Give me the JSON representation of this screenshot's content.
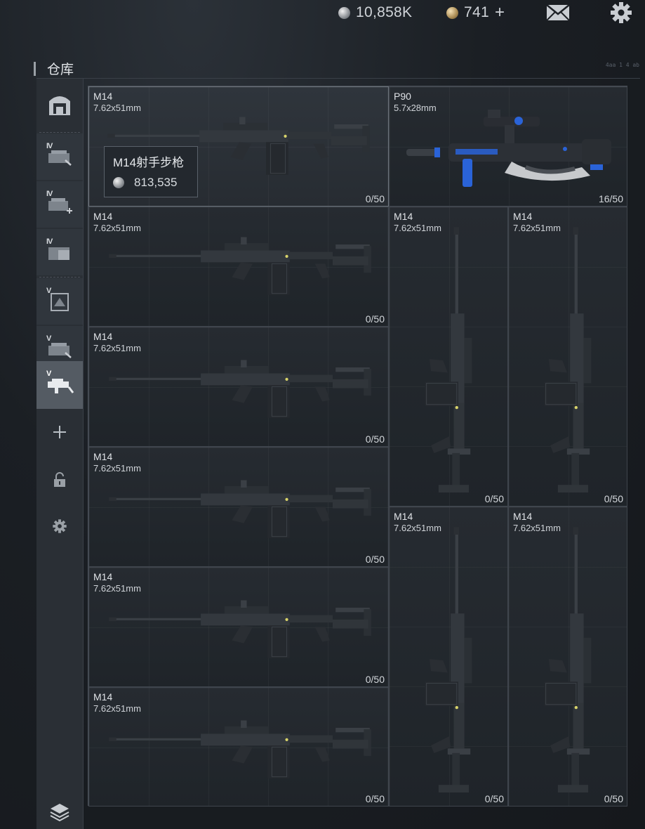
{
  "topbar": {
    "silver_amount": "10,858K",
    "gold_amount": "741",
    "gold_add_symbol": "+",
    "silver_icon": "silver-coin-icon",
    "gold_icon": "gold-coin-icon",
    "mail_icon": "mail-icon",
    "settings_icon": "gear-icon"
  },
  "storage": {
    "title": "仓库",
    "corner_tag": "4aa 1 4 ab"
  },
  "sidebar": {
    "items": [
      {
        "icon": "safe-box-icon",
        "tier": ""
      },
      {
        "icon": "weapon-case-icon",
        "tier": "IV"
      },
      {
        "icon": "weapon-case-add-icon",
        "tier": "IV"
      },
      {
        "icon": "folder-case-icon",
        "tier": "IV"
      },
      {
        "icon": "backpack-case-icon",
        "tier": "V"
      },
      {
        "icon": "weapon-case-icon",
        "tier": "V"
      },
      {
        "icon": "rifle-case-icon",
        "tier": "V"
      },
      {
        "icon": "plus-icon",
        "tier": ""
      },
      {
        "icon": "lock-icon",
        "tier": ""
      },
      {
        "icon": "gear-icon",
        "tier": ""
      }
    ],
    "bottom_icon": "layers-icon"
  },
  "grid": {
    "items": [
      {
        "name": "M14",
        "caliber": "7.62x51mm",
        "count": "0/50"
      },
      {
        "name": "P90",
        "caliber": "5.7x28mm",
        "count": "16/50"
      },
      {
        "name": "M14",
        "caliber": "7.62x51mm",
        "count": "0/50"
      },
      {
        "name": "M14",
        "caliber": "7.62x51mm",
        "count": "0/50"
      },
      {
        "name": "M14",
        "caliber": "7.62x51mm",
        "count": "0/50"
      },
      {
        "name": "M14",
        "caliber": "7.62x51mm",
        "count": "0/50"
      },
      {
        "name": "M14",
        "caliber": "7.62x51mm",
        "count": "0/50"
      },
      {
        "name": "M14",
        "caliber": "7.62x51mm",
        "count": "0/50"
      },
      {
        "name": "M14",
        "caliber": "7.62x51mm",
        "count": "0/50"
      },
      {
        "name": "M14",
        "caliber": "7.62x51mm",
        "count": "0/50"
      },
      {
        "name": "M14",
        "caliber": "7.62x51mm",
        "count": "0/50"
      }
    ],
    "tooltip": {
      "name": "M14射手步枪",
      "price": "813,535"
    }
  },
  "colors": {
    "accent_blue": "#2a63d8",
    "panel": "#2a2f35",
    "active": "#545b63"
  }
}
